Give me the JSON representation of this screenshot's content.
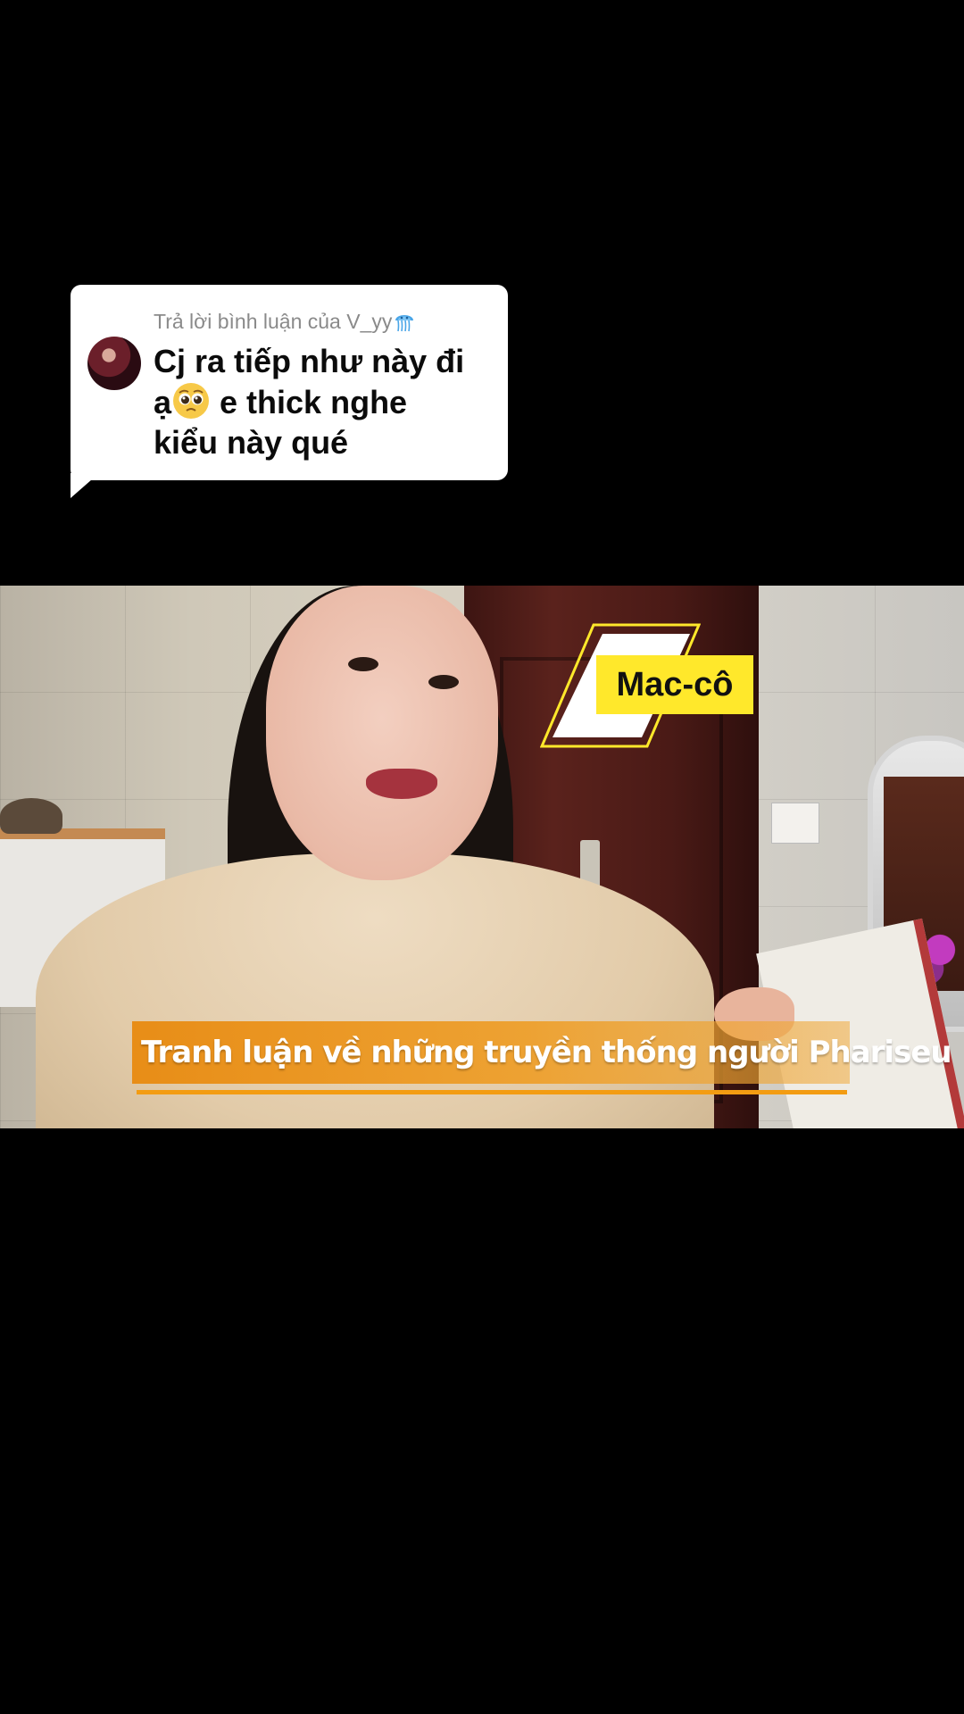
{
  "reply_card": {
    "header": "Trả lời bình luận của V_yy",
    "header_icon": "jellyfish-emoji-icon",
    "comment_line1": "Cj ra tiếp như này đi",
    "comment_line2_prefix": "ạ",
    "comment_emoji": "pleading-face-emoji-icon",
    "comment_line2_suffix": " e thick nghe",
    "comment_line3": "kiểu này qué"
  },
  "video": {
    "tag_label": "Mac-cô",
    "subtitle": "Tranh luận về những truyền thống người Phariseu",
    "colors": {
      "tag_yellow": "#ffe82b",
      "subtitle_orange": "#e88c14",
      "underline_orange": "#f39c12"
    }
  }
}
